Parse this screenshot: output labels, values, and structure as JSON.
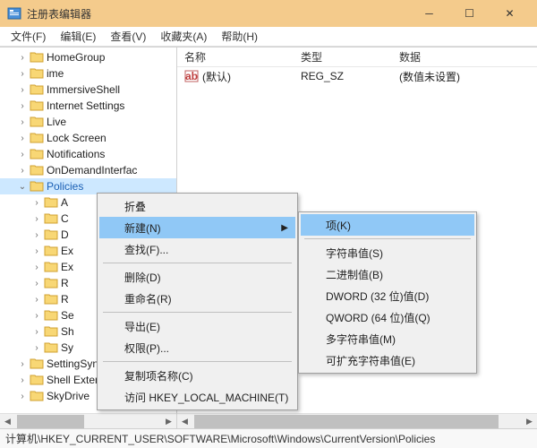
{
  "window": {
    "title": "注册表编辑器"
  },
  "menubar": {
    "file": "文件(F)",
    "edit": "编辑(E)",
    "view": "查看(V)",
    "favorites": "收藏夹(A)",
    "help": "帮助(H)"
  },
  "tree": {
    "items": [
      {
        "label": "HomeGroup",
        "expanded": false,
        "depth": 1
      },
      {
        "label": "ime",
        "expanded": false,
        "depth": 1
      },
      {
        "label": "ImmersiveShell",
        "expanded": false,
        "depth": 1
      },
      {
        "label": "Internet Settings",
        "expanded": false,
        "depth": 1
      },
      {
        "label": "Live",
        "expanded": false,
        "depth": 1
      },
      {
        "label": "Lock Screen",
        "expanded": false,
        "depth": 1
      },
      {
        "label": "Notifications",
        "expanded": false,
        "depth": 1
      },
      {
        "label": "OnDemandInterfac",
        "expanded": false,
        "depth": 1
      },
      {
        "label": "Policies",
        "expanded": true,
        "selected": true,
        "depth": 1
      },
      {
        "label": "A",
        "expanded": false,
        "depth": 2
      },
      {
        "label": "C",
        "expanded": false,
        "depth": 2
      },
      {
        "label": "D",
        "expanded": false,
        "depth": 2
      },
      {
        "label": "Ex",
        "expanded": false,
        "depth": 2
      },
      {
        "label": "Ex",
        "expanded": false,
        "depth": 2
      },
      {
        "label": "R",
        "expanded": false,
        "depth": 2
      },
      {
        "label": "R",
        "expanded": false,
        "depth": 2
      },
      {
        "label": "Se",
        "expanded": false,
        "depth": 2
      },
      {
        "label": "Sh",
        "expanded": false,
        "depth": 2
      },
      {
        "label": "Sy",
        "expanded": false,
        "depth": 2
      },
      {
        "label": "SettingSync",
        "expanded": false,
        "depth": 1
      },
      {
        "label": "Shell Extensions",
        "expanded": false,
        "depth": 1
      },
      {
        "label": "SkyDrive",
        "expanded": false,
        "depth": 1
      }
    ]
  },
  "list": {
    "headers": {
      "name": "名称",
      "type": "类型",
      "data": "数据"
    },
    "rows": [
      {
        "name": "(默认)",
        "type": "REG_SZ",
        "data": "(数值未设置)"
      }
    ]
  },
  "context_menu": {
    "collapse": "折叠",
    "new": "新建(N)",
    "find": "查找(F)...",
    "delete": "删除(D)",
    "rename": "重命名(R)",
    "export": "导出(E)",
    "permissions": "权限(P)...",
    "copy_key_name": "复制项名称(C)",
    "goto_hklm": "访问 HKEY_LOCAL_MACHINE(T)"
  },
  "submenu": {
    "key": "项(K)",
    "string": "字符串值(S)",
    "binary": "二进制值(B)",
    "dword": "DWORD (32 位)值(D)",
    "qword": "QWORD (64 位)值(Q)",
    "multi_string": "多字符串值(M)",
    "expandable": "可扩充字符串值(E)"
  },
  "statusbar": {
    "path": "计算机\\HKEY_CURRENT_USER\\SOFTWARE\\Microsoft\\Windows\\CurrentVersion\\Policies"
  }
}
